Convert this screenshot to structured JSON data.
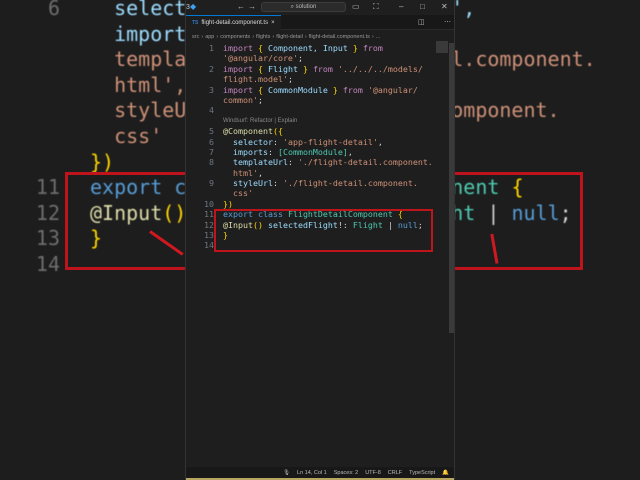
{
  "colors": {
    "kw": "#c586c0",
    "br": "#ffd700",
    "id": "#9cdcfe",
    "str": "#ce9178",
    "cls": "#4ec9b0",
    "dec": "#dcdcaa",
    "blue": "#569cd6",
    "pl": "#d4d4d4",
    "accent": "#c0141c"
  },
  "titlebar": {
    "search": "solution",
    "logo": "vscode-icon"
  },
  "tab": {
    "icon": "TS",
    "label": "flight-detail.component.ts",
    "close": "×"
  },
  "breadcrumb": [
    "src",
    "app",
    "components",
    "flights",
    "flight-detail",
    "flight-detail.component.ts",
    "..."
  ],
  "codelens": "Windsurf: Refactor | Explain",
  "code": [
    {
      "n": "1",
      "t": [
        [
          "import ",
          "kw"
        ],
        [
          "{ ",
          "br"
        ],
        [
          "Component, Input ",
          "id"
        ],
        [
          "} ",
          "br"
        ],
        [
          "from",
          "kw"
        ]
      ]
    },
    {
      "n": "",
      "t": [
        [
          "'@angular/core'",
          "str"
        ],
        [
          ";",
          "pl"
        ]
      ]
    },
    {
      "n": "2",
      "t": [
        [
          "import ",
          "kw"
        ],
        [
          "{ ",
          "br"
        ],
        [
          "Flight ",
          "id"
        ],
        [
          "} ",
          "br"
        ],
        [
          "from ",
          "kw"
        ],
        [
          "'../../../models/",
          "str"
        ]
      ]
    },
    {
      "n": "",
      "t": [
        [
          "flight.model'",
          "str"
        ],
        [
          ";",
          "pl"
        ]
      ]
    },
    {
      "n": "3",
      "t": [
        [
          "import ",
          "kw"
        ],
        [
          "{ ",
          "br"
        ],
        [
          "CommonModule ",
          "id"
        ],
        [
          "} ",
          "br"
        ],
        [
          "from ",
          "kw"
        ],
        [
          "'@angular/",
          "str"
        ]
      ]
    },
    {
      "n": "",
      "t": [
        [
          "common'",
          "str"
        ],
        [
          ";",
          "pl"
        ]
      ]
    },
    {
      "n": "4",
      "t": []
    },
    {
      "n": "lens",
      "t": []
    },
    {
      "n": "5",
      "t": [
        [
          "@Component",
          "dec"
        ],
        [
          "({",
          "br"
        ]
      ]
    },
    {
      "n": "6",
      "t": [
        [
          "  selector",
          "id"
        ],
        [
          ": ",
          "pl"
        ],
        [
          "'app-flight-detail'",
          "str"
        ],
        [
          ",",
          "pl"
        ]
      ]
    },
    {
      "n": "7",
      "t": [
        [
          "  imports",
          "id"
        ],
        [
          ": ",
          "pl"
        ],
        [
          "[CommonModule]",
          "cls"
        ],
        [
          ",",
          "pl"
        ]
      ]
    },
    {
      "n": "8",
      "t": [
        [
          "  templateUrl",
          "id"
        ],
        [
          ": ",
          "pl"
        ],
        [
          "'./flight-detail.component.",
          "str"
        ]
      ]
    },
    {
      "n": "",
      "t": [
        [
          "  html'",
          "str"
        ],
        [
          ",",
          "pl"
        ]
      ]
    },
    {
      "n": "9",
      "t": [
        [
          "  styleUrl",
          "id"
        ],
        [
          ": ",
          "pl"
        ],
        [
          "'./flight-detail.component.",
          "str"
        ]
      ]
    },
    {
      "n": "",
      "t": [
        [
          "  css'",
          "str"
        ]
      ]
    },
    {
      "n": "10",
      "t": [
        [
          "})",
          "br"
        ]
      ]
    },
    {
      "n": "11",
      "t": [
        [
          "export ",
          "blue"
        ],
        [
          "class ",
          "blue"
        ],
        [
          "FlightDetailComponent ",
          "cls"
        ],
        [
          "{",
          "br"
        ]
      ]
    },
    {
      "n": "12",
      "t": [
        [
          "@Input",
          "dec"
        ],
        [
          "() ",
          "br"
        ],
        [
          "selectedFlight",
          "id"
        ],
        [
          "!: ",
          "pl"
        ],
        [
          "Flight ",
          "cls"
        ],
        [
          "| ",
          "pl"
        ],
        [
          "null",
          "blue"
        ],
        [
          ";",
          "pl"
        ]
      ]
    },
    {
      "n": "13",
      "t": [
        [
          "}",
          "br"
        ]
      ]
    },
    {
      "n": "14",
      "t": []
    }
  ],
  "background": [
    {
      "n": "6",
      "t": [
        [
          "  selector: 'app-flight-detail',",
          "id"
        ]
      ]
    },
    {
      "n": "",
      "t": [
        [
          "  imports: [CommonModule],",
          "id"
        ]
      ]
    },
    {
      "n": "",
      "t": [
        [
          "  templateUrl: './flight-detail.component.",
          "str"
        ]
      ]
    },
    {
      "n": "",
      "t": [
        [
          "  html',",
          "str"
        ]
      ]
    },
    {
      "n": "",
      "t": [
        [
          "  styleUrl: './flight-detail.component.",
          "str"
        ]
      ]
    },
    {
      "n": "",
      "t": [
        [
          "  css'",
          "str"
        ]
      ]
    },
    {
      "n": "",
      "t": [
        [
          "})",
          "br"
        ]
      ]
    },
    {
      "n": "11",
      "t": [
        [
          "export class ",
          "blue"
        ],
        [
          "FlightDetailComponent ",
          "cls"
        ],
        [
          "{",
          "br"
        ]
      ]
    },
    {
      "n": "12",
      "t": [
        [
          "@Input",
          "dec"
        ],
        [
          "() ",
          "br"
        ],
        [
          "selectedFlight",
          "id"
        ],
        [
          "!: ",
          "pl"
        ],
        [
          "Flight ",
          "cls"
        ],
        [
          "| ",
          "pl"
        ],
        [
          "null",
          "blue"
        ],
        [
          ";",
          "pl"
        ]
      ]
    },
    {
      "n": "13",
      "t": [
        [
          "}",
          "br"
        ]
      ]
    },
    {
      "n": "14",
      "t": []
    }
  ],
  "status": {
    "position": "Ln 14, Col 1",
    "spaces": "Spaces: 2",
    "encoding": "UTF-8",
    "eol": "CRLF",
    "language": "TypeScript"
  }
}
